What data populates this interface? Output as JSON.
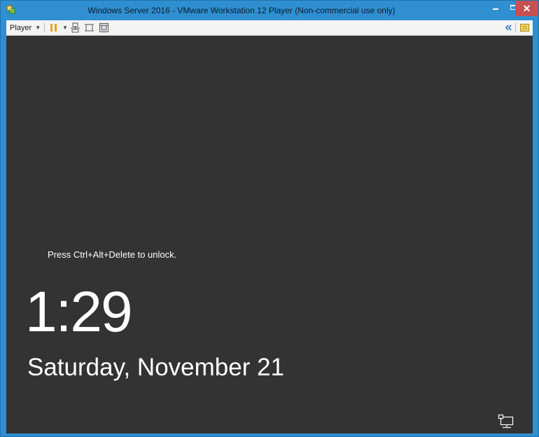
{
  "window": {
    "title": "Windows Server 2016 - VMware Workstation 12 Player (Non-commercial use only)",
    "app_icon": "vmware-player-icon",
    "controls": {
      "minimize_icon": "minimize-icon",
      "maximize_icon": "maximize-icon",
      "close_glyph": "✕"
    }
  },
  "toolbar": {
    "player_menu_label": "Player",
    "caret_glyph": "▼",
    "items": [
      {
        "name": "pause-icon",
        "color": "#e8a11c"
      },
      {
        "name": "send-ctrl-alt-del-icon"
      },
      {
        "name": "fit-guest-icon"
      },
      {
        "name": "unity-icon"
      },
      {
        "name": "collapse-toolbar-icon"
      },
      {
        "name": "message-log-icon"
      }
    ]
  },
  "lock_screen": {
    "unlock_hint": "Press Ctrl+Alt+Delete to unlock.",
    "time": "1:29",
    "date": "Saturday, November 21",
    "network_icon": "network-icon",
    "background_color": "#333333"
  },
  "colors": {
    "title_bar": "#2f8fd0",
    "close_button": "#c75050",
    "toolbar": "#f3f3f3"
  }
}
